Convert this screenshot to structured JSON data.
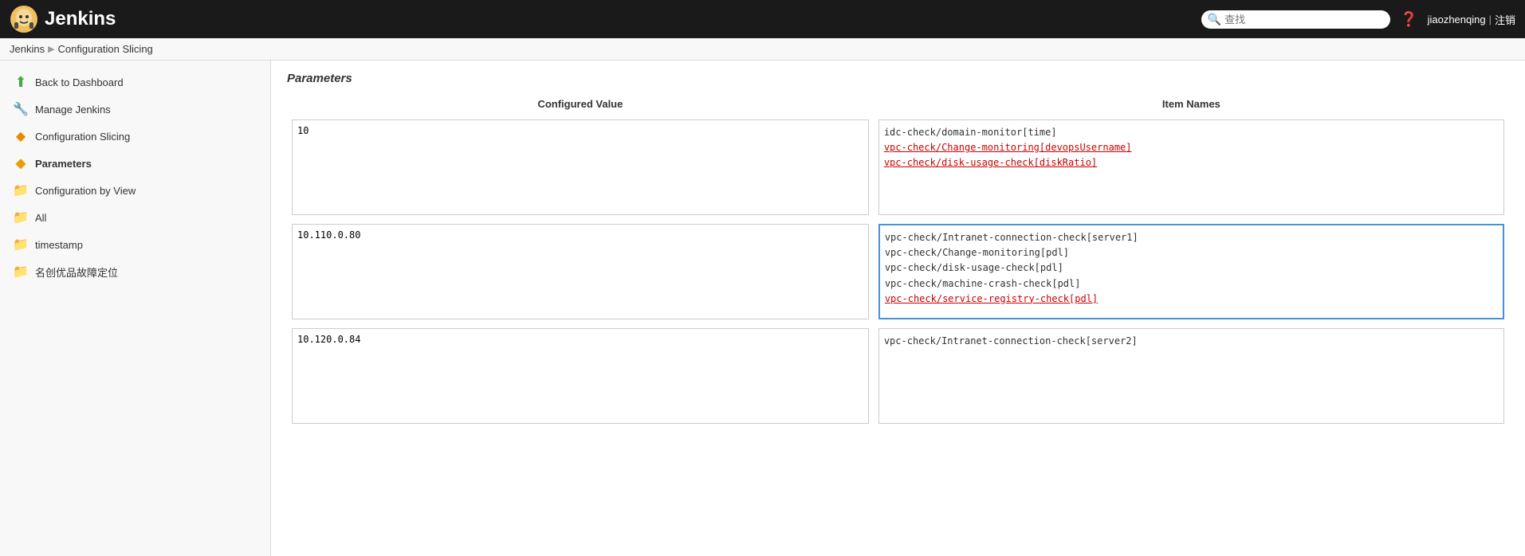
{
  "header": {
    "title": "Jenkins",
    "search_placeholder": "查找",
    "help_icon": "❓",
    "username": "jiaozhenqing",
    "logout_label": "注销",
    "divider": "|"
  },
  "breadcrumb": {
    "items": [
      "Jenkins",
      "Configuration Slicing"
    ]
  },
  "sidebar": {
    "items": [
      {
        "id": "back-dashboard",
        "label": "Back to Dashboard",
        "icon": "⬆",
        "icon_type": "back"
      },
      {
        "id": "manage-jenkins",
        "label": "Manage Jenkins",
        "icon": "🔧",
        "icon_type": "manage"
      },
      {
        "id": "configuration-slicing",
        "label": "Configuration Slicing",
        "icon": "◆",
        "icon_type": "slicing"
      },
      {
        "id": "parameters",
        "label": "Parameters",
        "icon": "◆",
        "icon_type": "params",
        "active": true
      },
      {
        "id": "configuration-by-view",
        "label": "Configuration by View",
        "icon": "📁",
        "icon_type": "folder"
      },
      {
        "id": "all",
        "label": "All",
        "icon": "📁",
        "icon_type": "folder"
      },
      {
        "id": "timestamp",
        "label": "timestamp",
        "icon": "📁",
        "icon_type": "folder"
      },
      {
        "id": "mingchuang",
        "label": "名创优品故障定位",
        "icon": "📁",
        "icon_type": "folder"
      }
    ]
  },
  "content": {
    "title": "Parameters",
    "columns": {
      "configured_value": "Configured Value",
      "item_names": "Item Names"
    },
    "rows": [
      {
        "value": "10",
        "names": [
          {
            "text": "idc-check/domain-monitor[time]",
            "underline": false
          },
          {
            "text": "vpc-check/Change-monitoring[devopsUsername]",
            "underline": true
          },
          {
            "text": "vpc-check/disk-usage-check[diskRatio]",
            "underline": true
          }
        ],
        "focused": false
      },
      {
        "value": "10.110.0.80",
        "names": [
          {
            "text": "vpc-check/Intranet-connection-check[server1]",
            "underline": false
          },
          {
            "text": "vpc-check/Change-monitoring[pdl]",
            "underline": false
          },
          {
            "text": "vpc-check/disk-usage-check[pdl]",
            "underline": false
          },
          {
            "text": "vpc-check/machine-crash-check[pdl]",
            "underline": false
          },
          {
            "text": "vpc-check/service-registry-check[pdl]",
            "underline": true
          }
        ],
        "focused": true
      },
      {
        "value": "10.120.0.84",
        "names": [
          {
            "text": "vpc-check/Intranet-connection-check[server2]",
            "underline": false
          }
        ],
        "focused": false
      }
    ]
  }
}
